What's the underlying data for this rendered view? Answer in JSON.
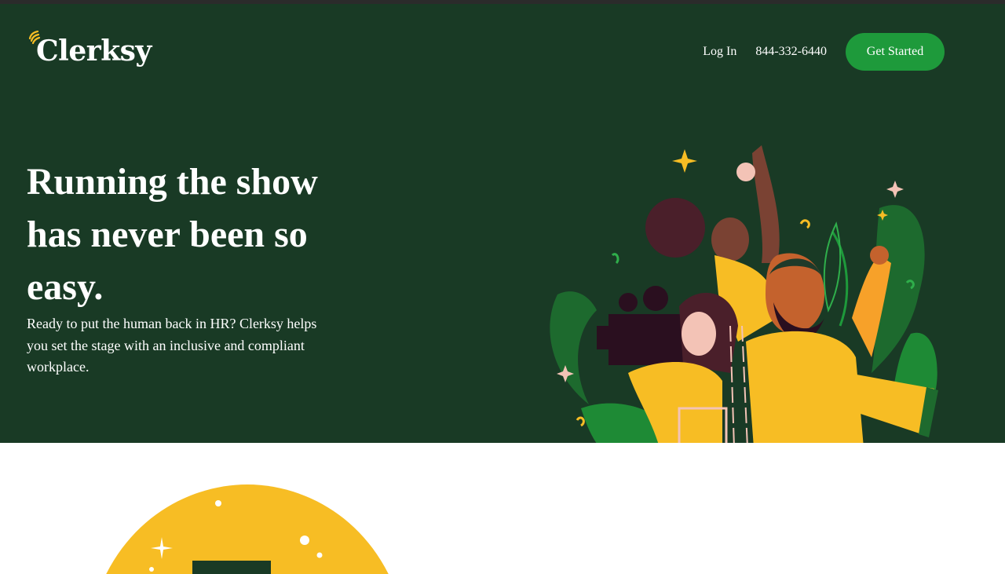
{
  "brand": {
    "name": "Clerksy"
  },
  "nav": {
    "login_label": "Log In",
    "phone": "844-332-6440",
    "cta_label": "Get Started"
  },
  "hero": {
    "headline": "Running the show has never been so easy.",
    "subtext": "Ready to put the human back in HR? Clerksy helps you set the stage with an inclusive and compliant workplace."
  },
  "colors": {
    "hero_bg": "#193a25",
    "cta_green": "#1e9a3b",
    "accent_yellow": "#f7bd24",
    "text_white": "#ffffff"
  },
  "icons": {
    "logo_mark": "clapper-arc-icon",
    "illustration": "film-crew-illustration",
    "section_art": "yellow-dome-illustration"
  }
}
